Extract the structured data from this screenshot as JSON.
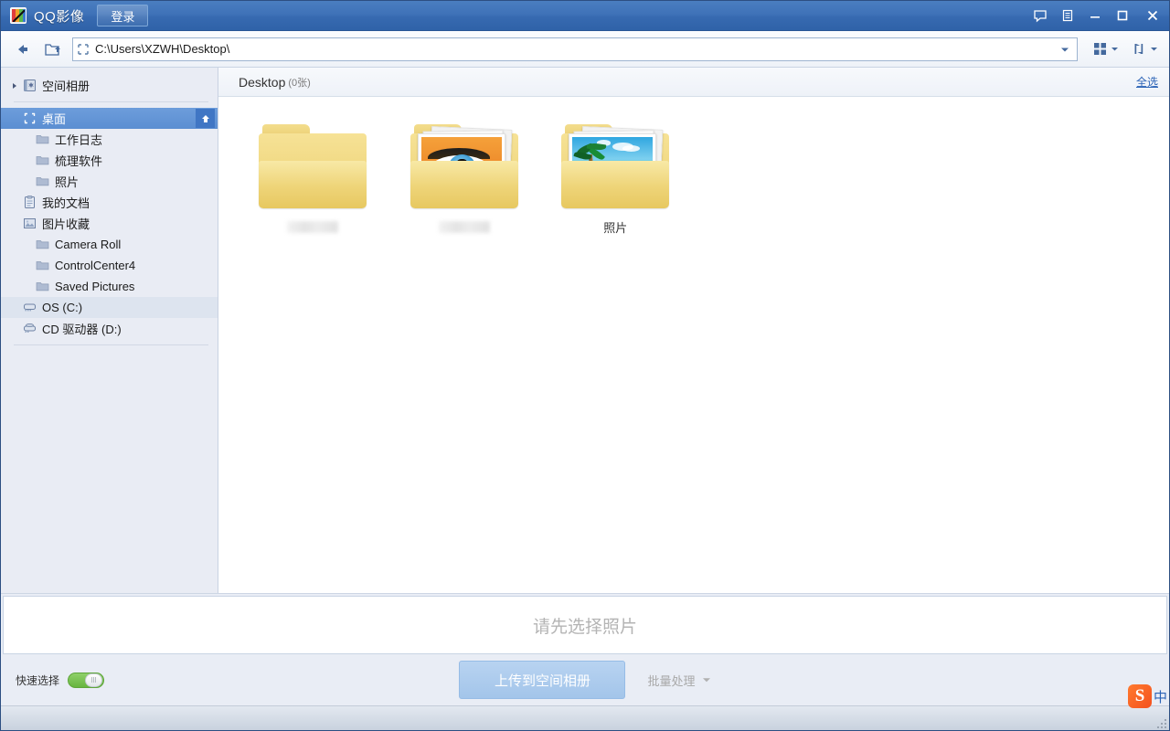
{
  "titlebar": {
    "app_logo_icon": "qq-photo-logo-icon",
    "app_title": "QQ影像",
    "login_label": "登录",
    "buttons": [
      {
        "name": "feedback-icon",
        "glyph": "speech-bubble"
      },
      {
        "name": "menu-icon",
        "glyph": "menu-list"
      },
      {
        "name": "minimize-icon",
        "glyph": "minimize"
      },
      {
        "name": "maximize-icon",
        "glyph": "maximize"
      },
      {
        "name": "close-icon",
        "glyph": "close"
      }
    ]
  },
  "toolbar": {
    "back_icon": "back-arrow-icon",
    "up_icon": "up-folder-icon",
    "address_icon": "folder-target-icon",
    "address_value": "C:\\Users\\XZWH\\Desktop\\",
    "address_placeholder": "C:\\",
    "address_dropdown_icon": "chevron-down-icon",
    "view_icon": "grid-view-icon",
    "sort_icon": "sort-icon"
  },
  "sidebar": {
    "items": [
      {
        "label": "空间相册",
        "icon": "album-star-icon",
        "level": 0,
        "caret": true,
        "state": "normal"
      },
      {
        "label": "桌面",
        "icon": "desktop-icon",
        "level": 0,
        "caret": false,
        "state": "selected",
        "badge": "up-arrow-icon"
      },
      {
        "label": "工作日志",
        "icon": "folder-icon",
        "level": 1,
        "caret": false,
        "state": "normal"
      },
      {
        "label": "梳理软件",
        "icon": "folder-icon",
        "level": 1,
        "caret": false,
        "state": "normal"
      },
      {
        "label": "照片",
        "icon": "folder-icon",
        "level": 1,
        "caret": false,
        "state": "normal"
      },
      {
        "label": "我的文档",
        "icon": "documents-icon",
        "level": 0,
        "caret": false,
        "state": "normal"
      },
      {
        "label": "图片收藏",
        "icon": "pictures-icon",
        "level": 0,
        "caret": false,
        "state": "normal"
      },
      {
        "label": "Camera Roll",
        "icon": "folder-icon",
        "level": 1,
        "caret": false,
        "state": "normal"
      },
      {
        "label": "ControlCenter4",
        "icon": "folder-icon",
        "level": 1,
        "caret": false,
        "state": "normal"
      },
      {
        "label": "Saved Pictures",
        "icon": "folder-icon",
        "level": 1,
        "caret": false,
        "state": "normal"
      },
      {
        "label": "OS (C:)",
        "icon": "drive-icon",
        "level": 0,
        "caret": false,
        "state": "hovered"
      },
      {
        "label": "CD 驱动器 (D:)",
        "icon": "cd-drive-icon",
        "level": 0,
        "caret": false,
        "state": "normal"
      }
    ]
  },
  "content": {
    "folder_title": "Desktop",
    "photo_count": "(0张)",
    "select_all_label": "全选",
    "tiles": [
      {
        "name_redacted": true,
        "label": "",
        "art": "plain-folder"
      },
      {
        "name_redacted": true,
        "label": "",
        "art": "eye-photo-folder"
      },
      {
        "name_redacted": false,
        "label": "照片",
        "art": "beach-photo-folder"
      }
    ]
  },
  "bottom": {
    "dropzone_placeholder": "请先选择照片",
    "quick_select_label": "快速选择",
    "quick_select_on": true,
    "upload_label": "上传到空间相册",
    "batch_label": "批量处理",
    "batch_caret_icon": "chevron-down-icon"
  },
  "ime": {
    "logo_text": "S",
    "mode_label": "中"
  },
  "colors": {
    "titlebar": "#3f72b8",
    "selection": "#5b8ed2",
    "sidebar_bg": "#e9ecf4",
    "link": "#2b63b6",
    "toggle_on": "#67b53f",
    "upload_disabled": "#a3c5ea",
    "folder_yellow": "#eed478"
  }
}
